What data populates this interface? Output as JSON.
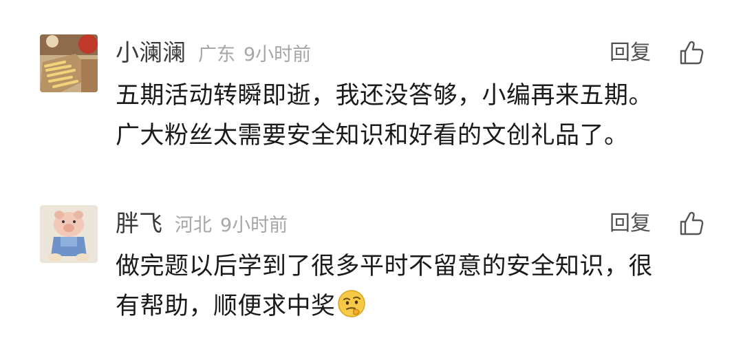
{
  "comments": [
    {
      "username": "小澜澜",
      "location": "广东",
      "time": "9小时前",
      "reply_label": "回复",
      "text_lines": [
        "五期活动转瞬即逝，我还没答够，小编再来五期。",
        "广大粉丝太需要安全知识和好看的文创礼品了。"
      ],
      "avatar_icon": "food-photo-avatar",
      "like_icon": "thumbs-up-icon"
    },
    {
      "username": "胖飞",
      "location": "河北",
      "time": "9小时前",
      "reply_label": "回复",
      "text_lines": [
        "做完题以后学到了很多平时不留意的安全知识，很",
        "有帮助，顺便求中奖"
      ],
      "trailing_emoji": "thinking-face-emoji",
      "avatar_icon": "pig-toy-avatar",
      "like_icon": "thumbs-up-icon"
    }
  ],
  "colors": {
    "username": "#3a3a3a",
    "meta": "#a6a6a6",
    "body_text": "#1a1a1a",
    "reply": "#505050",
    "background": "#ffffff"
  }
}
